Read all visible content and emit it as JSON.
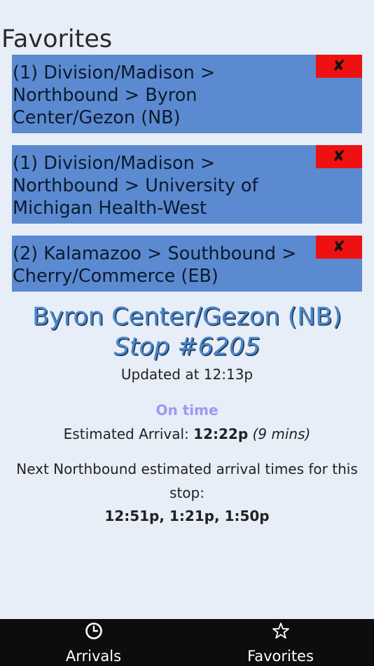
{
  "header": {
    "title": "Favorites"
  },
  "favorites": [
    {
      "label": "(1) Division/Madison > Northbound > Byron Center/Gezon (NB)",
      "remove": "✘"
    },
    {
      "label": "(1) Division/Madison > Northbound > University of Michigan Health-West",
      "remove": "✘"
    },
    {
      "label": "(2) Kalamazoo > Southbound > Cherry/Commerce (EB)",
      "remove": "✘"
    }
  ],
  "stop": {
    "name": "Byron Center/Gezon (NB)",
    "number": "Stop #6205",
    "updated": "Updated at 12:13p",
    "status": "On time",
    "status_color": "#9a9af0",
    "arrival_label": "Estimated Arrival:",
    "arrival_time": "12:22p",
    "arrival_mins": "(9 mins)",
    "next_text": "Next Northbound estimated arrival times for this stop:",
    "next_times": "12:51p, 1:21p, 1:50p"
  },
  "tabs": [
    {
      "label": "Arrivals",
      "icon": "clock-icon"
    },
    {
      "label": "Favorites",
      "icon": "star-icon"
    }
  ],
  "colors": {
    "favorite_bg": "#5b8ad0",
    "remove_bg": "#ee1111",
    "tabbar_bg": "#0d0d0d"
  }
}
